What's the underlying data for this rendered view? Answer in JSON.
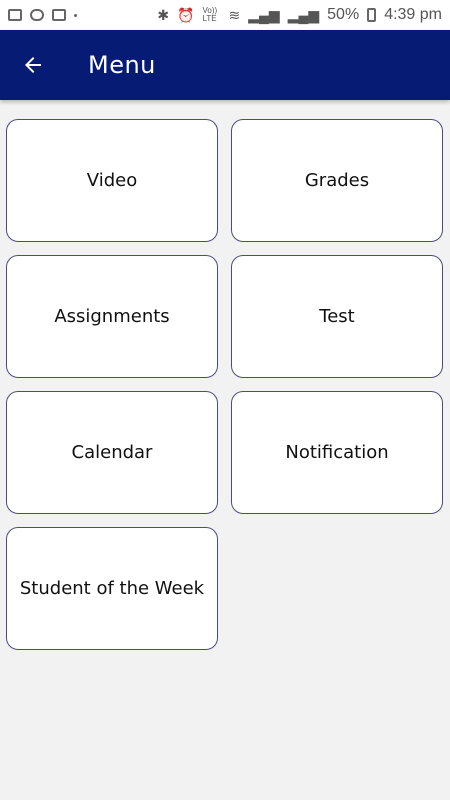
{
  "status_bar": {
    "battery": "50%",
    "time": "4:39 pm",
    "volte": "Vo)) LTE"
  },
  "app_bar": {
    "title": "Menu"
  },
  "menu": {
    "items": [
      {
        "label": "Video"
      },
      {
        "label": "Grades"
      },
      {
        "label": "Assignments"
      },
      {
        "label": "Test"
      },
      {
        "label": "Calendar"
      },
      {
        "label": "Notification"
      },
      {
        "label": "Student of the Week"
      }
    ]
  }
}
